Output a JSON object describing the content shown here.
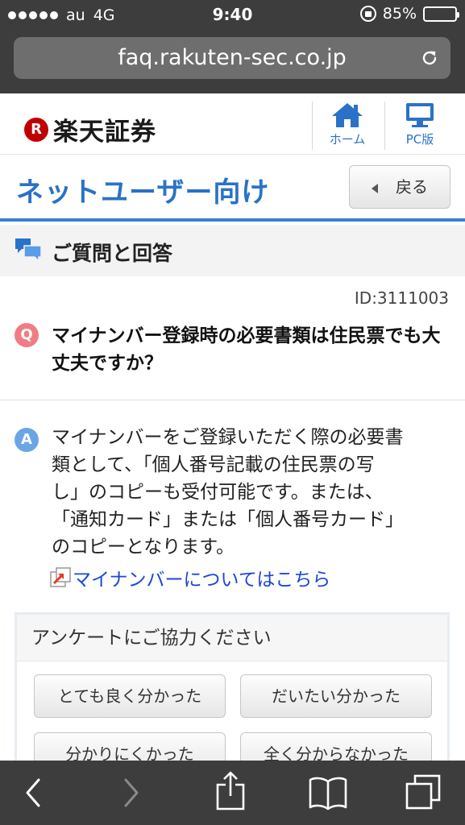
{
  "status": {
    "carrier": "au",
    "network": "4G",
    "time": "9:40",
    "battery": "85%",
    "battery_level": 0.85
  },
  "browser": {
    "url": "faq.rakuten-sec.co.jp"
  },
  "header": {
    "logo_mark": "R",
    "logo_text": "楽天証券",
    "home_label": "ホーム",
    "pc_label": "PC版"
  },
  "title_bar": {
    "title": "ネットユーザー向け",
    "back_label": "戻る"
  },
  "section": {
    "title": "ご質問と回答"
  },
  "qa": {
    "id": "ID:3111003",
    "q_badge": "Q",
    "question": "マイナンバー登録時の必要書類は住民票でも大丈夫ですか？",
    "a_badge": "A",
    "answer_lines": [
      "マイナンバーをご登録いただく際の必要書",
      "類として、「個人番号記載の住民票の写",
      "し」のコピーも受付可能です。または、",
      "「通知カード」または「個人番号カード」",
      "のコピーとなります。"
    ],
    "link_text": "マイナンバーについてはこちら"
  },
  "survey": {
    "title": "アンケートにご協力ください",
    "options": [
      "とても良く分かった",
      "だいたい分かった",
      "分かりにくかった",
      "全く分からなかった"
    ]
  },
  "colors": {
    "brand_red": "#bf0000",
    "accent_blue": "#2a72c7",
    "link_blue": "#1a47d8",
    "q_badge": "#f17c84",
    "a_badge": "#6aa6e6"
  }
}
